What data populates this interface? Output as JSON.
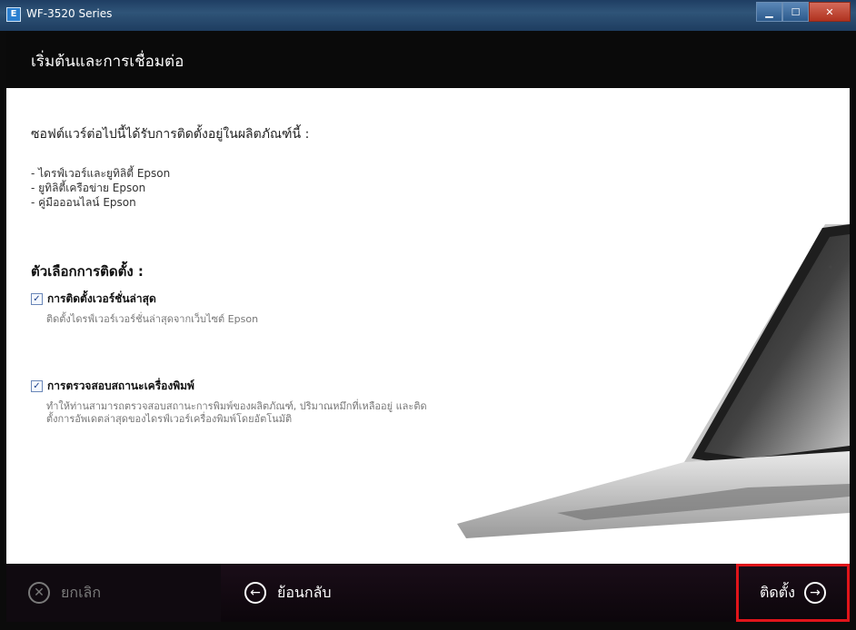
{
  "window": {
    "title": "WF-3520 Series",
    "min_icon": "minimize-icon",
    "max_icon": "maximize-icon",
    "close_icon": "close-icon"
  },
  "header": {
    "title": "เริ่มต้นและการเชื่อมต่อ"
  },
  "content": {
    "intro": "ซอฟต์แวร์ต่อไปนี้ได้รับการติดตั้งอยู่ในผลิตภัณฑ์นี้ :",
    "software_list": [
      "- ไดรฟ์เวอร์และยูทิลิตี้ Epson",
      "- ยูทิลิตี้เครือข่าย Epson",
      "- คู่มือออนไลน์ Epson"
    ],
    "options_title": "ตัวเลือกการติดตั้ง :",
    "option1": {
      "label": "การติดตั้งเวอร์ชั่นล่าสุด",
      "desc": "ติดตั้งไดรฟ์เวอร์เวอร์ชั่นล่าสุดจากเว็บไซต์ Epson",
      "checked": true
    },
    "option2": {
      "label": "การตรวจสอบสถานะเครื่องพิมพ์",
      "desc": "ทำให้ท่านสามารถตรวจสอบสถานะการพิมพ์ของผลิตภัณฑ์, ปริมาณหมึกที่เหลืออยู่ และติดตั้งการอัพเดตล่าสุดของไดรฟ์เวอร์เครื่องพิมพ์โดยอัตโนมัติ",
      "checked": true
    }
  },
  "footer": {
    "cancel_label": "ยกเลิก",
    "back_label": "ย้อนกลับ",
    "install_label": "ติดตั้ง",
    "highlight_color": "#e0141a"
  }
}
